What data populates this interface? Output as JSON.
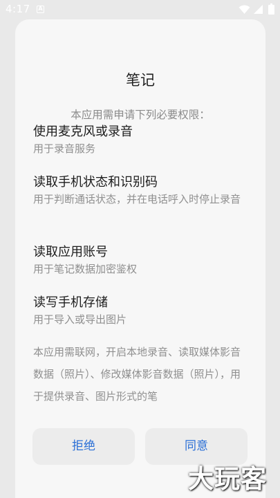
{
  "status_bar": {
    "time": "4:17",
    "indicator": "A",
    "icons": [
      "wifi-icon",
      "signal-icon",
      "battery-icon"
    ]
  },
  "dialog": {
    "title": "笔记",
    "intro": "本应用需申请下列必要权限：",
    "permissions": [
      {
        "title": "使用麦克风或录音",
        "desc": "用于录音服务"
      },
      {
        "title": "读取手机状态和识别码",
        "desc": "用于判断通话状态，并在电话呼入时停止录音"
      },
      {
        "title": "读取应用账号",
        "desc": "用于笔记数据加密鉴权"
      },
      {
        "title": "读写手机存储",
        "desc": "用于导入或导出图片"
      }
    ],
    "footer_text": "本应用需联网，开启本地录音、读取媒体影音数据（照片）、修改媒体影音数据（照片），用于提供录音、图片形式的笔",
    "buttons": {
      "reject": "拒绝",
      "agree": "同意"
    }
  },
  "watermark": "大玩客",
  "colors": {
    "accent": "#2a6fd6",
    "dialog_bg": "#f7f7f7",
    "backdrop": "#e9e9e9"
  }
}
